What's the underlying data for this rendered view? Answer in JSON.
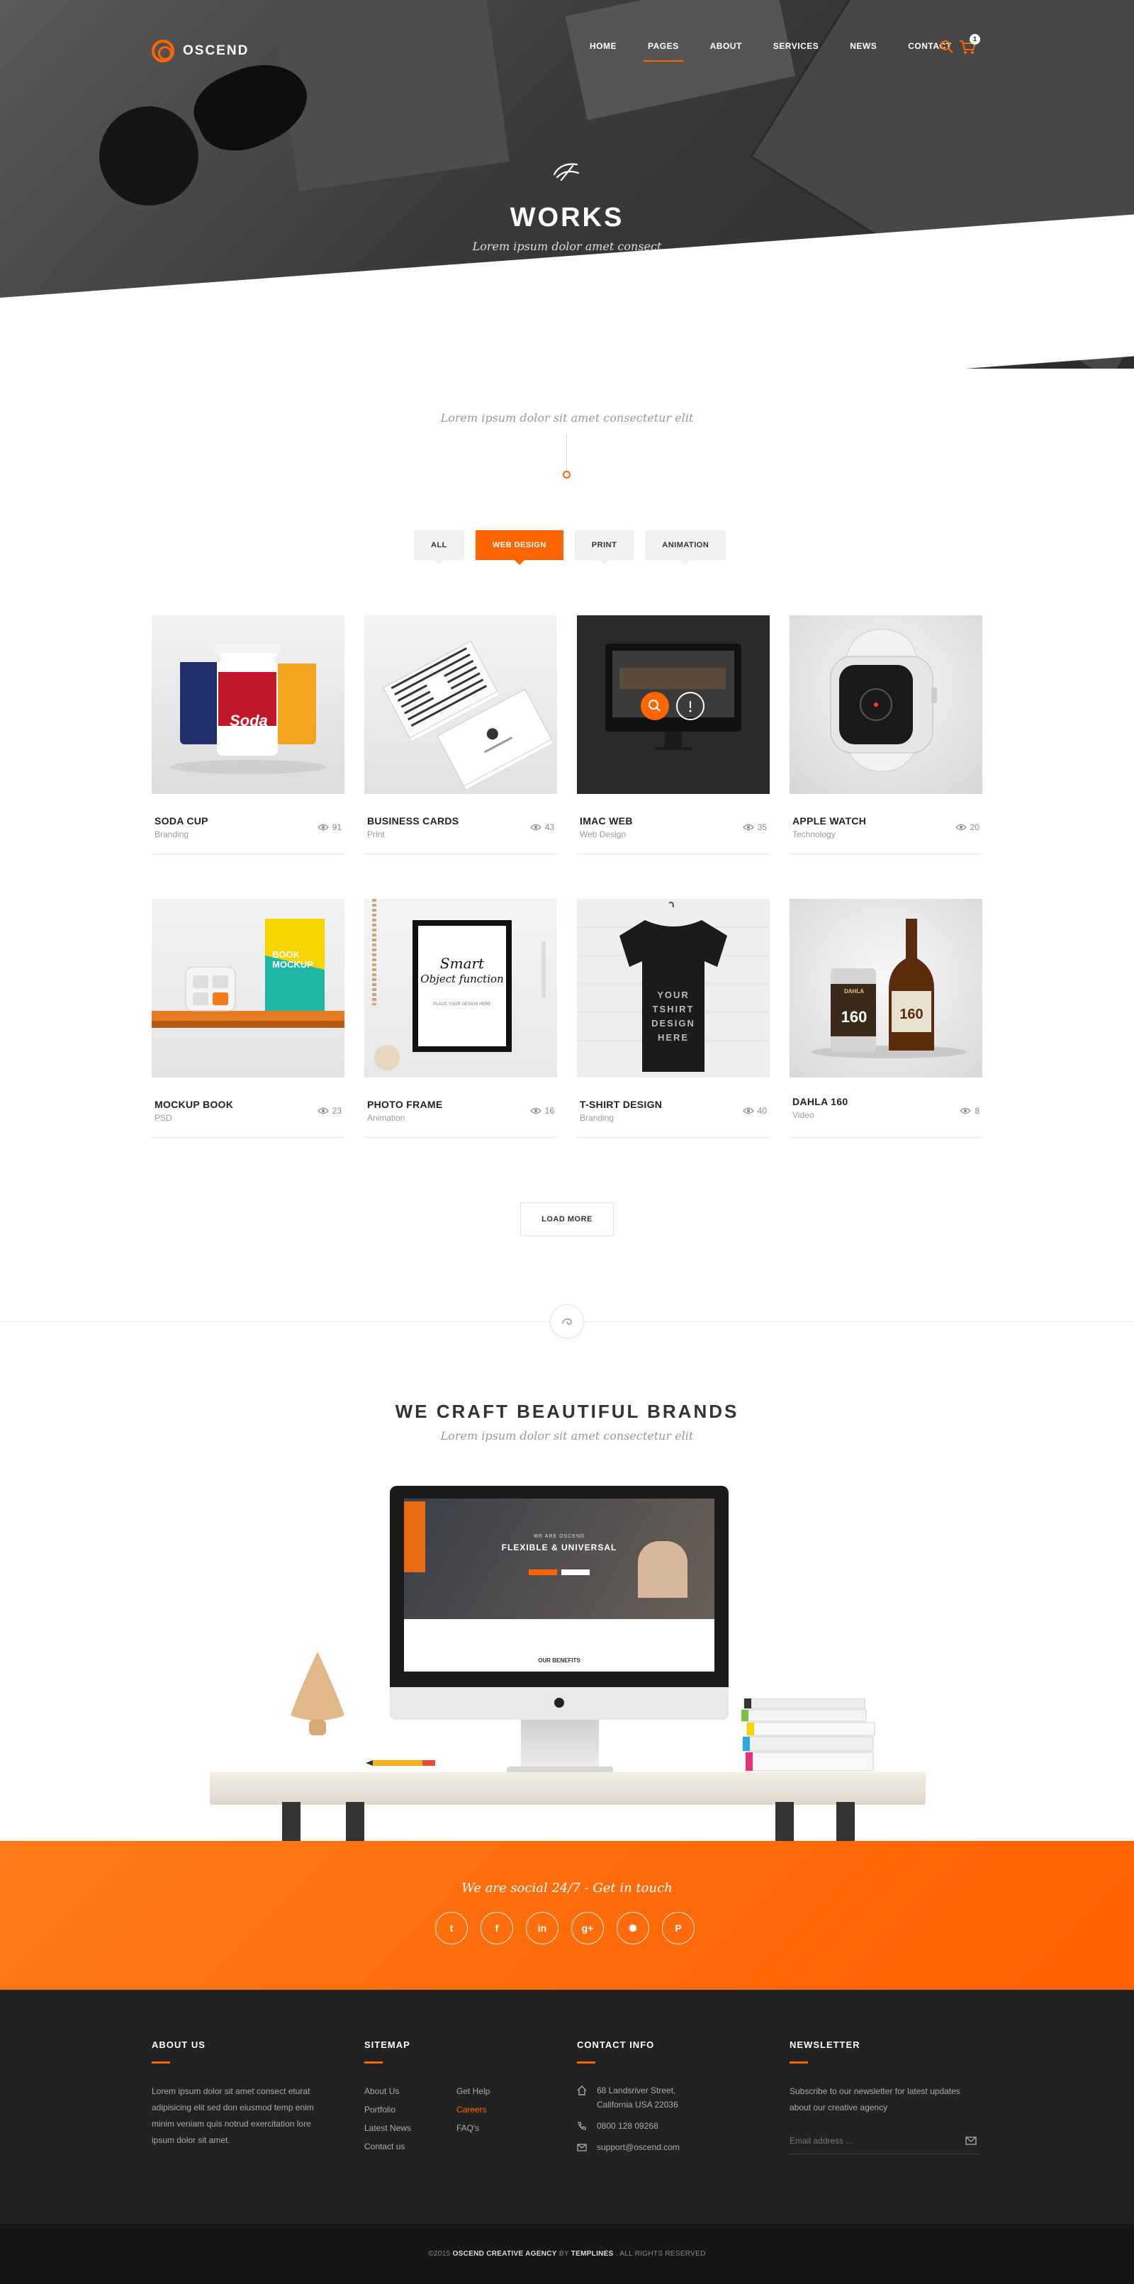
{
  "header": {
    "brand": "OSCEND",
    "nav": [
      "HOME",
      "PAGES",
      "ABOUT",
      "SERVICES",
      "NEWS",
      "CONTACT"
    ],
    "active_nav": "PAGES",
    "cart_count": "1"
  },
  "hero": {
    "title": "WORKS",
    "subtitle": "Lorem ipsum dolor amet consect"
  },
  "intro": "Lorem ipsum dolor sit amet consectetur elit",
  "filters": [
    "ALL",
    "WEB DESIGN",
    "PRINT",
    "ANIMATION"
  ],
  "active_filter": "WEB DESIGN",
  "works": [
    {
      "title": "SODA CUP",
      "category": "Branding",
      "views": "91"
    },
    {
      "title": "BUSINESS CARDS",
      "category": "Print",
      "views": "43"
    },
    {
      "title": "IMAC WEB",
      "category": "Web Design",
      "views": "35"
    },
    {
      "title": "APPLE WATCH",
      "category": "Technology",
      "views": "20"
    },
    {
      "title": "MOCKUP BOOK",
      "category": "PSD",
      "views": "23"
    },
    {
      "title": "PHOTO FRAME",
      "category": "Animation",
      "views": "16"
    },
    {
      "title": "T-SHIRT DESIGN",
      "category": "Branding",
      "views": "40"
    },
    {
      "title": "DAHLA 160",
      "category": "Video",
      "views": "8"
    }
  ],
  "thumb_text": {
    "soda": "Soda",
    "book": "BOOK MOCKUP",
    "frame_line1": "Smart",
    "frame_line2": "Object function",
    "frame_small": "PLACE YOUR DESIGN HERE",
    "tshirt": [
      "YOUR",
      "TSHIRT",
      "DESIGN",
      "HERE"
    ],
    "beer": "160",
    "beer_brand": "DAHLA"
  },
  "load_more": "LOAD MORE",
  "craft": {
    "title": "WE CRAFT BEAUTIFUL BRANDS",
    "subtitle": "Lorem ipsum dolor sit amet consectetur elit"
  },
  "screen": {
    "kicker": "WE ARE OSCEND",
    "headline": "FLEXIBLE & UNIVERSAL",
    "section": "OUR BENEFITS"
  },
  "social": {
    "tagline": "We are social 24/7 - Get in touch",
    "icons": [
      "t",
      "f",
      "in",
      "g+",
      "✺",
      "P"
    ]
  },
  "footer": {
    "about": {
      "heading": "ABOUT US",
      "text": "Lorem ipsum dolor sit amet consect eturat adipisicing elit sed don eiusmod temp enim minim veniam quis notrud exercitation lore ipsum dolor sit amet."
    },
    "sitemap": {
      "heading": "SITEMAP",
      "col1": [
        "About Us",
        "Portfolio",
        "Latest News",
        "Contact us"
      ],
      "col2": [
        "Get Help",
        "Careers",
        "FAQ's"
      ],
      "highlighted": "Careers"
    },
    "contact": {
      "heading": "CONTACT INFO",
      "address": "68 Landsriver Street, California USA 22036",
      "phone": "0800 128 09268",
      "email": "support@oscend.com"
    },
    "newsletter": {
      "heading": "NEWSLETTER",
      "text": "Subscribe to our newsletter for latest updates about our creative agency",
      "placeholder": "Email address ..."
    }
  },
  "copyright": {
    "prefix": "©2015 ",
    "agency": "OSCEND CREATIVE AGENCY",
    "by": " BY ",
    "author": "TEMPLINES",
    "suffix": " . ALL RIGHTS RESERVED"
  },
  "colors": {
    "accent": "#ff6600",
    "dark": "#222222",
    "footer_bottom": "#161616"
  }
}
